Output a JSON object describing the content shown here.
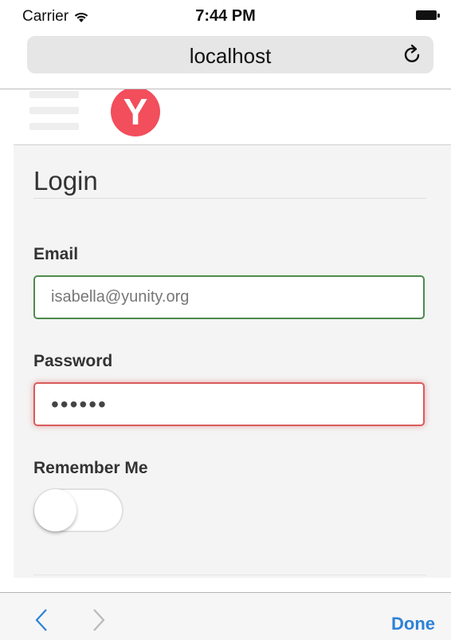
{
  "status_bar": {
    "carrier": "Carrier",
    "time": "7:44 PM"
  },
  "browser": {
    "url": "localhost"
  },
  "header": {
    "logo_text": "Y",
    "logo_color": "#f24e5c"
  },
  "login": {
    "title": "Login",
    "email_label": "Email",
    "email_value": "isabella@yunity.org",
    "password_label": "Password",
    "password_value": "••••••",
    "remember_label": "Remember Me",
    "remember_on": false
  },
  "toolbar": {
    "done_label": "Done",
    "accent_color": "#2d82d8"
  }
}
